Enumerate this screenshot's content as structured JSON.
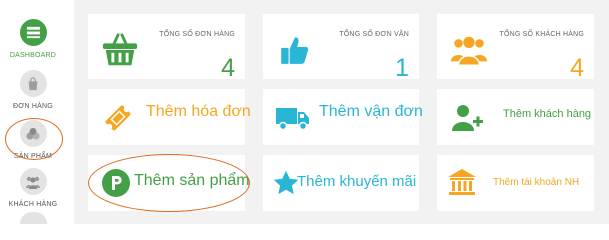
{
  "colors": {
    "green": "#43a047",
    "blue": "#29b6d6",
    "orange": "#f6a623",
    "highlight": "#e06a1f"
  },
  "sidebar": {
    "items": [
      {
        "label": "DASHBOARD",
        "icon": "dashboard-icon",
        "active": true
      },
      {
        "label": "ĐƠN HÀNG",
        "icon": "shopping-bag-icon",
        "active": false
      },
      {
        "label": "SẢN PHẨM",
        "icon": "products-icon",
        "active": false
      },
      {
        "label": "KHÁCH HÀNG",
        "icon": "customers-icon",
        "active": false
      }
    ]
  },
  "stats": [
    {
      "label": "TỔNG SỐ ĐƠN HÀNG",
      "value": "4",
      "icon": "basket-icon"
    },
    {
      "label": "TỔNG SỐ ĐƠN VẬN",
      "value": "1",
      "icon": "thumbs-up-icon"
    },
    {
      "label": "TỔNG SỐ KHÁCH HÀNG",
      "value": "4",
      "icon": "customers-icon"
    }
  ],
  "actions": [
    {
      "label": "Thêm hóa đơn",
      "icon": "ticket-icon"
    },
    {
      "label": "Thêm vận đơn",
      "icon": "truck-icon"
    },
    {
      "label": "Thêm khách hàng",
      "icon": "add-user-icon"
    },
    {
      "label": "Thêm sản phẩm",
      "icon": "parking-icon"
    },
    {
      "label": "Thêm khuyến mãi",
      "icon": "star-icon"
    },
    {
      "label": "Thêm tài khoản NH",
      "icon": "bank-icon"
    }
  ]
}
